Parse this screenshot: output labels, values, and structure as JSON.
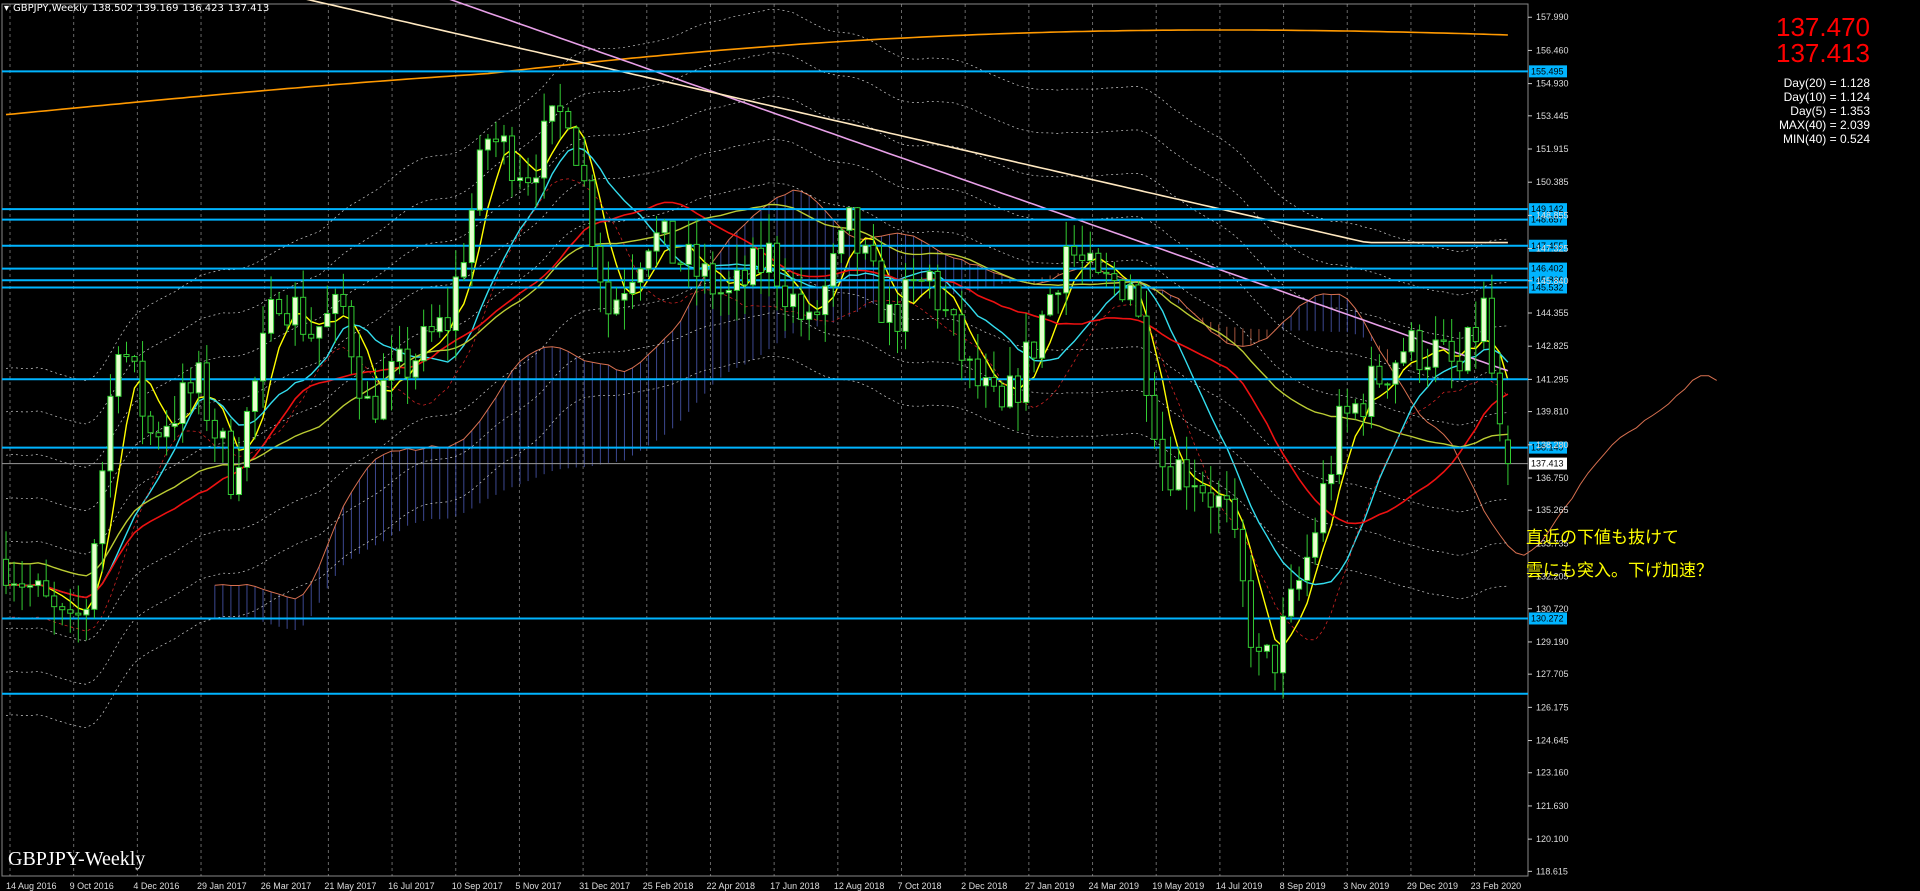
{
  "header": {
    "symbol": "GBPJPY,Weekly",
    "open": "138.502",
    "high": "139.169",
    "low": "136.423",
    "close": "137.413"
  },
  "price_panel": {
    "bid": "137.470",
    "ask": "137.413",
    "stats": [
      "Day(20) = 1.128",
      "Day(10) = 1.124",
      "Day(5) = 1.353",
      "MAX(40) = 2.039",
      "MIN(40) = 0.524"
    ]
  },
  "annotation": {
    "line1": "直近の下値も抜けて",
    "line2": "雲にも突入。下げ加速？"
  },
  "watermark": "GBPJPY-Weekly",
  "colors": {
    "background": "#000000",
    "bull_candle": "#e8ffd0",
    "bear_candle": "#33cc33",
    "hline": "#00b4ff",
    "cloud_bear": "#d87050",
    "cloud_bull": "#5060c0",
    "ma_yellow": "#ffff00",
    "ma_cyan": "#33ddee",
    "ma_red": "#ee1111",
    "ma_olive": "#bbcc33",
    "ma_orange": "#ff9900",
    "ma_pink": "#e8a0e8",
    "ma_cream": "#ffe8c0"
  },
  "chart_data": {
    "type": "candlestick",
    "ylim": [
      118.4,
      158.6
    ],
    "y_ticks": [
      "157.990",
      "156.460",
      "154.930",
      "153.445",
      "151.915",
      "150.385",
      "148.855",
      "147.325",
      "145.840",
      "144.355",
      "142.825",
      "141.295",
      "139.810",
      "138.280",
      "136.750",
      "135.265",
      "133.735",
      "132.205",
      "130.720",
      "129.190",
      "127.705",
      "126.175",
      "124.645",
      "123.160",
      "121.630",
      "120.100",
      "118.615"
    ],
    "x_labels": [
      "14 Aug 2016",
      "9 Oct 2016",
      "4 Dec 2016",
      "29 Jan 2017",
      "26 Mar 2017",
      "21 May 2017",
      "16 Jul 2017",
      "10 Sep 2017",
      "5 Nov 2017",
      "31 Dec 2017",
      "25 Feb 2018",
      "22 Apr 2018",
      "17 Jun 2018",
      "12 Aug 2018",
      "7 Oct 2018",
      "2 Dec 2018",
      "27 Jan 2019",
      "24 Mar 2019",
      "19 May 2019",
      "14 Jul 2019",
      "8 Sep 2019",
      "3 Nov 2019",
      "29 Dec 2019",
      "23 Feb 2020"
    ],
    "horizontal_levels": [
      {
        "value": 155.495,
        "label": "155.495"
      },
      {
        "value": 149.142,
        "label": "149.142"
      },
      {
        "value": 148.657,
        "label": "148.657"
      },
      {
        "value": 147.455,
        "label": "147.455"
      },
      {
        "value": 146.402,
        "label": "146.402"
      },
      {
        "value": 145.866,
        "label": "145.866"
      },
      {
        "value": 145.532,
        "label": "145.532"
      },
      {
        "value": 141.3,
        "label": ""
      },
      {
        "value": 138.149,
        "label": "138.149"
      },
      {
        "value": 137.413,
        "label": "137.413"
      },
      {
        "value": 130.272,
        "label": "130.272"
      },
      {
        "value": 126.8,
        "label": ""
      }
    ],
    "close_path": [
      [
        0,
        133.0
      ],
      [
        8,
        129.5
      ],
      [
        10,
        131.0
      ],
      [
        14,
        143.5
      ],
      [
        18,
        138.8
      ],
      [
        24,
        141.0
      ],
      [
        28,
        137.0
      ],
      [
        30,
        139.5
      ],
      [
        34,
        145.5
      ],
      [
        38,
        143.5
      ],
      [
        42,
        144.5
      ],
      [
        45,
        140.0
      ],
      [
        50,
        142.0
      ],
      [
        55,
        144.0
      ],
      [
        60,
        152.5
      ],
      [
        65,
        151.0
      ],
      [
        70,
        154.0
      ],
      [
        75,
        144.5
      ],
      [
        80,
        148.0
      ],
      [
        85,
        146.5
      ],
      [
        90,
        145.0
      ],
      [
        95,
        147.0
      ],
      [
        100,
        143.5
      ],
      [
        105,
        148.2
      ],
      [
        110,
        144.0
      ],
      [
        115,
        146.0
      ],
      [
        120,
        141.5
      ],
      [
        124,
        139.5
      ],
      [
        128,
        143.0
      ],
      [
        132,
        147.5
      ],
      [
        136,
        145.5
      ],
      [
        140,
        146.0
      ],
      [
        144,
        137.5
      ],
      [
        148,
        137.0
      ],
      [
        152,
        135.0
      ],
      [
        156,
        128.0
      ],
      [
        158,
        128.5
      ],
      [
        162,
        133.0
      ],
      [
        166,
        139.0
      ],
      [
        170,
        141.0
      ],
      [
        174,
        142.8
      ],
      [
        178,
        142.5
      ],
      [
        181,
        141.5
      ],
      [
        184,
        144.5
      ],
      [
        186,
        138.5
      ],
      [
        187,
        137.4
      ]
    ]
  }
}
